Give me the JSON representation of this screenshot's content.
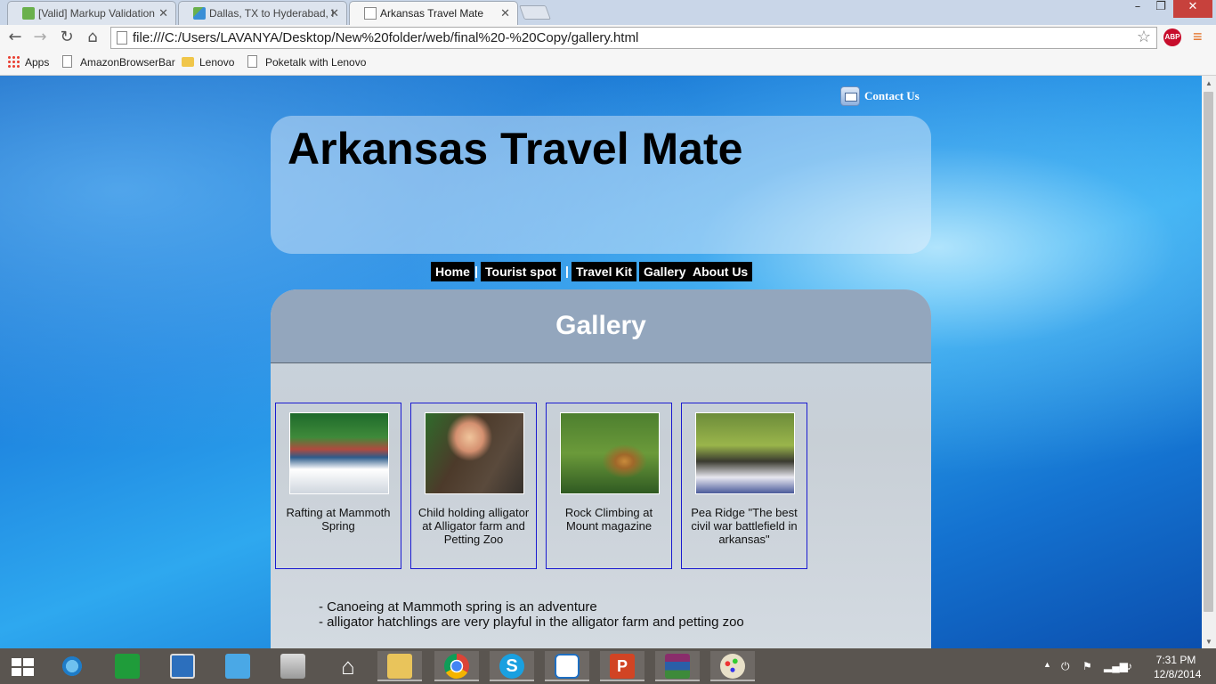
{
  "browser": {
    "tabs": [
      {
        "title": "[Valid] Markup Validation",
        "icon": "validator-favicon-icon"
      },
      {
        "title": "Dallas, TX to Hyderabad, I",
        "icon": "maps-favicon-icon"
      },
      {
        "title": "Arkansas Travel Mate",
        "icon": "page-favicon-icon",
        "active": true
      }
    ],
    "url": "file:///C:/Users/LAVANYA/Desktop/New%20folder/web/final%20-%20Copy/gallery.html",
    "abp_label": "ABP",
    "bookmarks": [
      {
        "label": "Apps",
        "icon": "apps-grid-icon"
      },
      {
        "label": "AmazonBrowserBar",
        "icon": "page-icon"
      },
      {
        "label": "Lenovo",
        "icon": "folder-icon"
      },
      {
        "label": "Poketalk with Lenovo",
        "icon": "page-icon"
      }
    ]
  },
  "page": {
    "contact_label": "Contact Us",
    "site_title": "Arkansas Travel Mate",
    "nav": [
      "Home",
      "Tourist spot",
      "Travel Kit",
      "Gallery",
      "About Us"
    ],
    "nav_separator": "|",
    "section_title": "Gallery",
    "gallery": [
      {
        "caption": "Rafting at Mammoth Spring",
        "image": "rafting-photo"
      },
      {
        "caption": "Child holding alligator at Alligator farm and Petting Zoo",
        "image": "alligator-photo"
      },
      {
        "caption": "Rock Climbing at Mount magazine",
        "image": "rock-climbing-photo"
      },
      {
        "caption": "Pea Ridge \"The best civil war battlefield in arkansas\"",
        "image": "pea-ridge-photo"
      }
    ],
    "descriptions": [
      "- Canoeing at Mammoth spring is an adventure",
      "- alligator hatchlings are very playful in the alligator farm and petting zoo"
    ]
  },
  "taskbar": {
    "apps": [
      "start",
      "internet-explorer",
      "store",
      "lenovo",
      "shopping",
      "photo",
      "home",
      "file-explorer",
      "chrome",
      "skype",
      "teamviewer",
      "powerpoint",
      "winrar",
      "paint"
    ],
    "time": "7:31 PM",
    "date": "12/8/2014"
  },
  "colors": {
    "nav_bg": "#000000",
    "card_border": "#1a1ad0",
    "close_button": "#c7413c"
  }
}
